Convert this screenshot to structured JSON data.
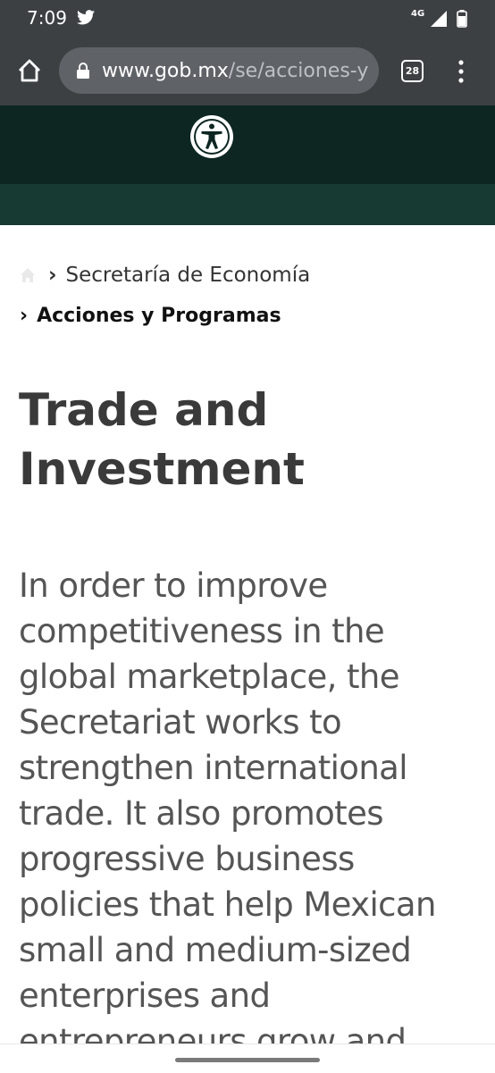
{
  "status_bar": {
    "time": "7:09",
    "network": "4G",
    "icons": [
      "twitter-icon",
      "signal-icon",
      "battery-icon"
    ]
  },
  "browser": {
    "url_host": "www.gob.mx",
    "url_path": "/se/acciones-y",
    "tab_count": "28",
    "icons": [
      "home-icon",
      "lock-icon",
      "tabs-icon",
      "more-vert-icon"
    ]
  },
  "site": {
    "accessibility_icon": "accessibility-icon",
    "header_color": "#0d2622",
    "subheader_color": "#173a33"
  },
  "breadcrumb": {
    "items": [
      {
        "label": "Secretaría de Economía"
      },
      {
        "label": "Acciones y Programas"
      }
    ]
  },
  "page": {
    "title": "Trade and Investment",
    "intro": "In order to improve competitiveness in the global marketplace, the Secretariat works to strengthen international trade. It also promotes progressive business policies that help Mexican small and medium-sized enterprises and entrepreneurs grow and succeed."
  }
}
